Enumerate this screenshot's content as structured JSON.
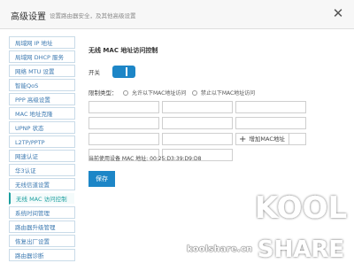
{
  "header": {
    "title": "高级设置",
    "subtitle": "设置路由器安全，及其他高级设置",
    "close_glyph": "✕"
  },
  "sidebar": {
    "items": [
      {
        "label": "局域网 IP 地址"
      },
      {
        "label": "局域网 DHCP 服务"
      },
      {
        "label": "网络 MTU 设置"
      },
      {
        "label": "智能QoS"
      },
      {
        "label": "PPP 高级设置"
      },
      {
        "label": "MAC 地址克隆"
      },
      {
        "label": "UPNP 状态"
      },
      {
        "label": "L2TP/PPTP"
      },
      {
        "label": "网速认证"
      },
      {
        "label": "华3认证"
      },
      {
        "label": "无线信道设置"
      },
      {
        "label": "无线 MAC 访问控制",
        "active": true
      },
      {
        "label": "系统时间管理"
      },
      {
        "label": "路由器升级管理"
      },
      {
        "label": "恢复出厂设置"
      },
      {
        "label": "路由器诊断"
      }
    ]
  },
  "main": {
    "section_title": "无线 MAC 地址访问控制",
    "switch_label": "开关",
    "switch_state": "on",
    "restrict_type_label": "限制类型：",
    "option_allow": "允许以下MAC地址访问",
    "option_deny": "禁止以下MAC地址访问",
    "mac_inputs": [
      "",
      "",
      "",
      "",
      "",
      "",
      "",
      "",
      "",
      "",
      ""
    ],
    "add_mac_label": "增加MAC地址",
    "current_mac_label": "当前使用设备 MAC 地址:",
    "current_mac_value": "00:25:D3:39:D9:D8",
    "save_label": "保存"
  },
  "watermark": {
    "site": "koolshare.cn",
    "logo_line1": "KOOL",
    "logo_line2": "SHARE"
  },
  "colors": {
    "accent": "#1d86c7",
    "sidebar_text": "#3d7ab1",
    "active_text": "#1a9e9e"
  }
}
